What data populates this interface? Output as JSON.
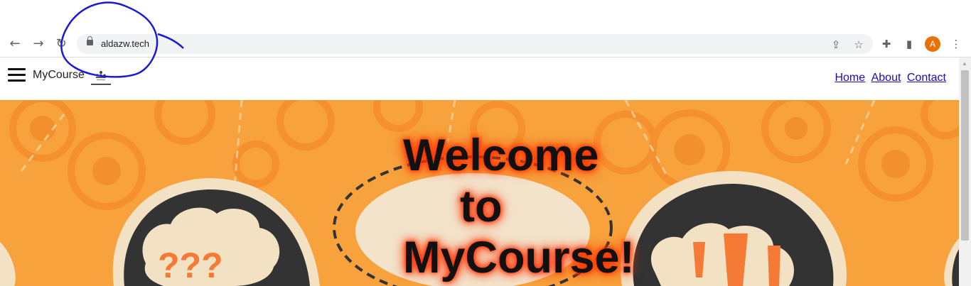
{
  "browser": {
    "url": "aldazw.tech",
    "avatar_initial": "A",
    "icons": [
      "back-icon",
      "forward-icon",
      "reload-icon",
      "lock-icon",
      "share-icon",
      "star-icon",
      "extensions-icon",
      "side-panel-icon",
      "menu-kebab-icon"
    ]
  },
  "site": {
    "brand": "MyCourse",
    "nav": {
      "home": "Home",
      "about": "About",
      "contact": "Contact"
    },
    "hero": {
      "line1": "Welcome",
      "line2": "to",
      "line3": "MyCourse!",
      "left_bubble_text": "???",
      "right_bubble_text": "!!!"
    }
  },
  "colors": {
    "hero_background": "#f7a23c",
    "link": "#1a0dab",
    "avatar": "#e8710a",
    "annotation": "#1a1ad6"
  }
}
